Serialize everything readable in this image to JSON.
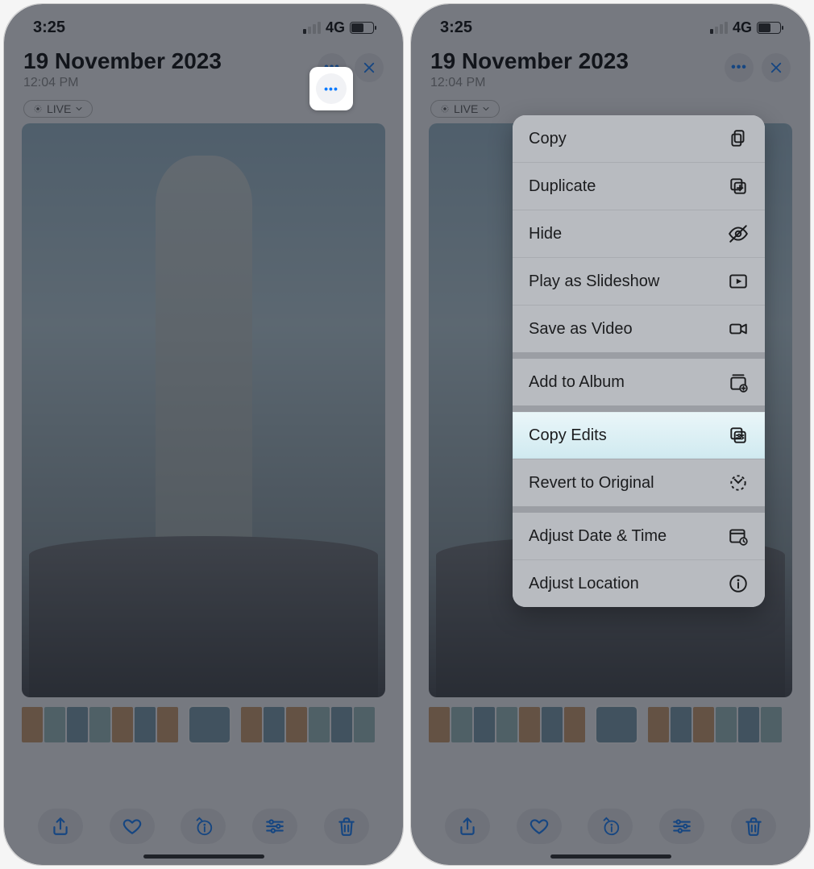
{
  "status": {
    "time": "3:25",
    "network": "4G"
  },
  "header": {
    "date": "19 November 2023",
    "time": "12:04 PM",
    "live_label": "LIVE"
  },
  "toolbar": {
    "share": "Share",
    "favorite": "Favorite",
    "info": "Info",
    "edit": "Edit",
    "delete": "Delete"
  },
  "menu": {
    "copy": "Copy",
    "duplicate": "Duplicate",
    "hide": "Hide",
    "play_slideshow": "Play as Slideshow",
    "save_as_video": "Save as Video",
    "add_to_album": "Add to Album",
    "copy_edits": "Copy Edits",
    "revert_original": "Revert to Original",
    "adjust_date_time": "Adjust Date & Time",
    "adjust_location": "Adjust Location"
  },
  "highlighted_menu_item": "copy_edits"
}
